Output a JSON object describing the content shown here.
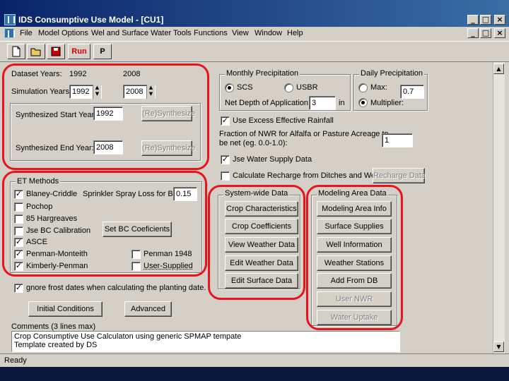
{
  "window": {
    "title": "IDS Consumptive Use Model - [CU1]",
    "min_glyph": "_",
    "restore_glyph": "□",
    "close_glyph": "×"
  },
  "menu": [
    "File",
    "Model Options",
    "Wel and Surface Water Tools",
    "Functions",
    "View",
    "Window",
    "Help"
  ],
  "toolbar": {
    "run_label": "Run",
    "p_label": "P"
  },
  "dataset": {
    "years_label": "Dataset Years:",
    "year_start": "1992",
    "year_end": "2008",
    "sim_label": "Simulation Years:",
    "sim_start": "1992",
    "sim_end": "2008",
    "synth_start_label": "Synthesized Start Year:",
    "synth_start": "1992",
    "synth_end_label": "Synthesized End Year:",
    "synth_end": "2008",
    "resynth_label": "(Re)Synthesize"
  },
  "et": {
    "title": "ET Methods",
    "blaney": "Blaney-Criddle",
    "pochop": "Pochop",
    "hargreaves": "85 Hargreaves",
    "use_bc": "Jse BC Calibration",
    "asce": "ASCE",
    "penman_monteith": "Penman-Monteith",
    "kimberly": "Kimberly-Penman",
    "penman1948": "Penman 1948",
    "user_supplied": "User-Supplied",
    "sprinkler_label": "Sprinkler Spray Loss for BC:",
    "sprinkler_value": "0.15",
    "set_bc_label": "Set BC Coeficients",
    "check_mark": "✓"
  },
  "ignore_frost": "gnore frost dates when calculating the planting date.",
  "initial_conditions": "Initial Conditions",
  "advanced": "Advanced",
  "monthly_precip": {
    "title": "Monthly Precipitation",
    "scs": "SCS",
    "usbr": "USBR",
    "net_depth_label": "Net Depth of Application:",
    "net_depth_value": "3",
    "unit": "in"
  },
  "daily_precip": {
    "title": "Daily Precipitation",
    "max": "Max:",
    "multiplier": "Multiplier:",
    "value": "0.7"
  },
  "use_excess": "Use Excess Effective Rainfall",
  "fraction": {
    "line1": "Fraction of NWR for Alfalfa or Pasture Acreage to",
    "line2": "be net (eg. 0.0-1.0):",
    "value": "1"
  },
  "use_water_supply": "Jse Water Supply Data",
  "calc_recharge": "Calculate Recharge from Ditches and Wells",
  "recharge_data": "Recharge Data",
  "system_wide": {
    "title": "System-wide Data",
    "buttons": [
      "Crop Characteristics",
      "Crop Coefficients",
      "View Weather Data",
      "Edit Weather Data",
      "Edit Surface Data"
    ]
  },
  "modeling_area": {
    "title": "Modeling Area Data",
    "buttons": [
      "Modeling Area Info",
      "Surface Supplies",
      "Well Information",
      "Weather Stations",
      "Add From DB",
      "User NWR",
      "Water Uptake"
    ]
  },
  "comments": {
    "label": "Comments (3 lines max)",
    "line1": "Crop Consumptive Use Calculaton using generic SPMAP tempate",
    "line2": "Template created by DS"
  },
  "status": "Ready"
}
